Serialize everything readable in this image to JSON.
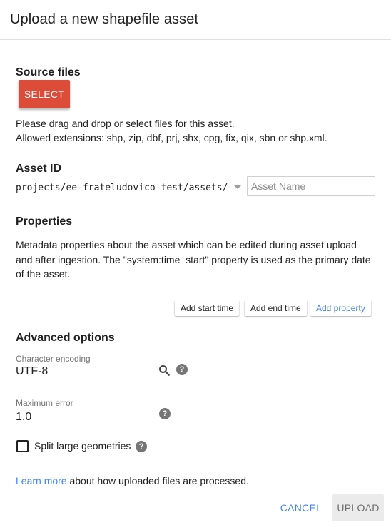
{
  "dialog": {
    "title": "Upload a new shapefile asset"
  },
  "source": {
    "heading": "Source files",
    "select_label": "SELECT",
    "instructions_line1": "Please drag and drop or select files for this asset.",
    "instructions_line2": "Allowed extensions: shp, zip, dbf, prj, shx, cpg, fix, qix, sbn or shp.xml."
  },
  "asset_id": {
    "heading": "Asset ID",
    "prefix": "projects/ee-frateludovico-test/assets/",
    "name_value": "",
    "name_placeholder": "Asset Name"
  },
  "properties": {
    "heading": "Properties",
    "desc_line1": "Metadata properties about the asset which can be edited during asset upload",
    "desc_line2": "and after ingestion. The \"system:time_start\" property is used as the primary date",
    "desc_line3": "of the asset.",
    "buttons": {
      "add_start_time": "Add start time",
      "add_end_time": "Add end time",
      "add_property": "Add property"
    }
  },
  "advanced": {
    "heading": "Advanced options",
    "encoding_label": "Character encoding",
    "encoding_value": "UTF-8",
    "max_error_label": "Maximum error",
    "max_error_value": "1.0",
    "split_label": "Split large geometries",
    "split_checked": false
  },
  "footer": {
    "learn_more": "Learn more",
    "learn_more_suffix": " about how uploaded files are processed.",
    "cancel": "CANCEL",
    "upload": "UPLOAD"
  },
  "icons": {
    "search": "search-icon",
    "help": "help-icon",
    "dropdown": "dropdown-arrow-icon"
  },
  "colors": {
    "select_button": "#dd4b39",
    "link": "#4285f4",
    "upload_disabled_bg": "#ebebeb"
  }
}
